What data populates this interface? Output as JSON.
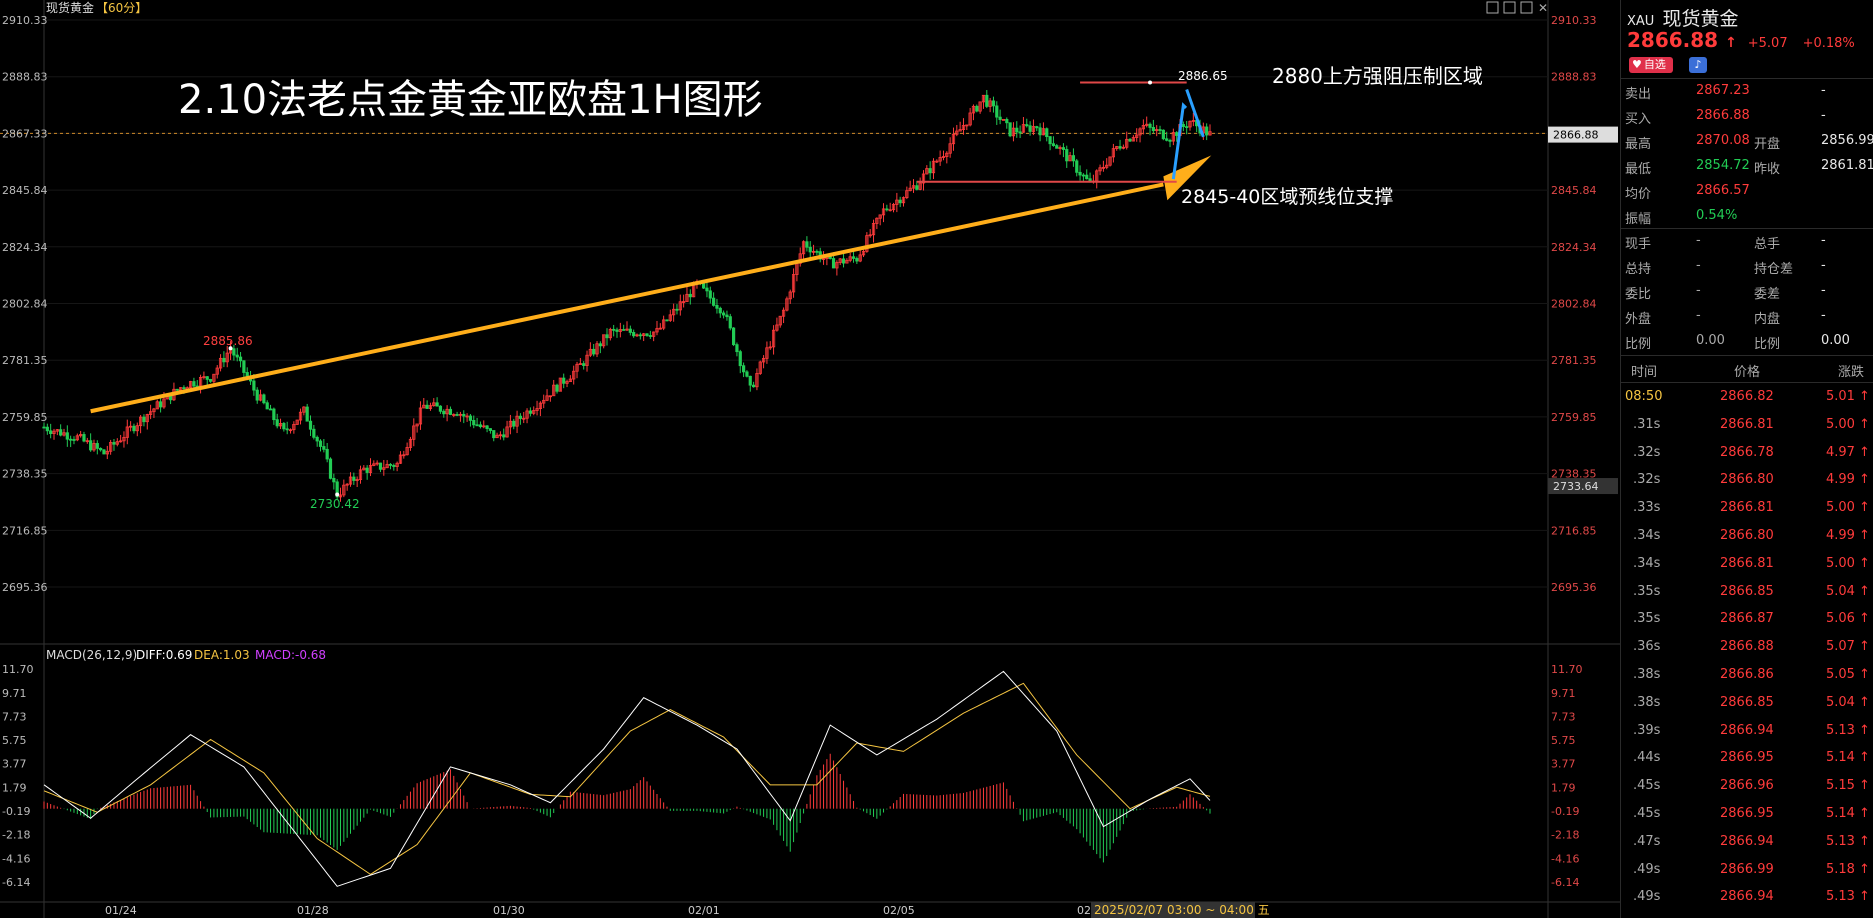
{
  "window": {
    "title": "现货黄金",
    "period": "【60分】",
    "toolbar_icons": [
      "layout-icon",
      "grid-icon",
      "window-icon",
      "close-icon"
    ]
  },
  "chart_data": [
    {
      "type": "candlestick",
      "title": "2.10法老点金黄金亚欧盘1H图形",
      "y_ticks": [
        2910.33,
        2888.83,
        2867.33,
        2845.84,
        2824.34,
        2802.84,
        2781.35,
        2759.85,
        2738.35,
        2716.85,
        2695.36
      ],
      "ylim": [
        2695.36,
        2910.33
      ],
      "x_ticks": [
        "01/24",
        "01/28",
        "01/30",
        "02/01",
        "02/05",
        "02"
      ],
      "cursor_label": "2025/02/07 03:00 ~ 04:00 五",
      "price_marker_last": "2866.88",
      "price_marker_low": "2733.64",
      "max_label": "2885.86",
      "peak_label": "2886.65",
      "min_label": "2730.42",
      "dashed_price": 2867.33,
      "key_points": [
        {
          "i": 0,
          "p": 2756
        },
        {
          "i": 10,
          "p": 2752
        },
        {
          "i": 18,
          "p": 2746
        },
        {
          "i": 30,
          "p": 2760
        },
        {
          "i": 42,
          "p": 2772
        },
        {
          "i": 50,
          "p": 2775
        },
        {
          "i": 56,
          "p": 2785.86
        },
        {
          "i": 64,
          "p": 2768
        },
        {
          "i": 72,
          "p": 2754
        },
        {
          "i": 78,
          "p": 2762
        },
        {
          "i": 84,
          "p": 2746
        },
        {
          "i": 88,
          "p": 2730.42
        },
        {
          "i": 96,
          "p": 2740
        },
        {
          "i": 106,
          "p": 2742
        },
        {
          "i": 114,
          "p": 2764
        },
        {
          "i": 124,
          "p": 2762
        },
        {
          "i": 136,
          "p": 2752
        },
        {
          "i": 148,
          "p": 2765
        },
        {
          "i": 160,
          "p": 2778
        },
        {
          "i": 170,
          "p": 2792
        },
        {
          "i": 184,
          "p": 2792
        },
        {
          "i": 196,
          "p": 2810
        },
        {
          "i": 204,
          "p": 2800
        },
        {
          "i": 212,
          "p": 2770
        },
        {
          "i": 222,
          "p": 2800
        },
        {
          "i": 228,
          "p": 2826
        },
        {
          "i": 236,
          "p": 2818
        },
        {
          "i": 244,
          "p": 2820
        },
        {
          "i": 252,
          "p": 2838
        },
        {
          "i": 262,
          "p": 2848
        },
        {
          "i": 270,
          "p": 2860
        },
        {
          "i": 282,
          "p": 2881
        },
        {
          "i": 290,
          "p": 2868
        },
        {
          "i": 298,
          "p": 2870
        },
        {
          "i": 306,
          "p": 2860
        },
        {
          "i": 314,
          "p": 2848
        },
        {
          "i": 322,
          "p": 2862
        },
        {
          "i": 330,
          "p": 2870
        },
        {
          "i": 338,
          "p": 2866
        },
        {
          "i": 344,
          "p": 2872
        },
        {
          "i": 350,
          "p": 2866.88
        }
      ],
      "annotations": [
        {
          "text": "2880上方强阻压制区域"
        },
        {
          "text": "2845-40区域预线位支撑"
        }
      ]
    },
    {
      "type": "macd",
      "header": "MACD(26,12,9)",
      "diff_label": "DIFF:0.69",
      "dea_label": "DEA:1.03",
      "macd_label": "MACD:-0.68",
      "y_ticks": [
        11.7,
        9.71,
        7.73,
        5.75,
        3.77,
        1.79,
        -0.19,
        -2.18,
        -4.16,
        -6.14
      ],
      "ylim": [
        -8.0,
        12.0
      ],
      "diff_points": [
        {
          "i": 0,
          "v": 2.0
        },
        {
          "i": 14,
          "v": -0.8
        },
        {
          "i": 28,
          "v": 2.5
        },
        {
          "i": 44,
          "v": 6.2
        },
        {
          "i": 60,
          "v": 3.5
        },
        {
          "i": 74,
          "v": -1.5
        },
        {
          "i": 88,
          "v": -6.5
        },
        {
          "i": 104,
          "v": -5.0
        },
        {
          "i": 122,
          "v": 3.5
        },
        {
          "i": 140,
          "v": 2.0
        },
        {
          "i": 152,
          "v": 0.5
        },
        {
          "i": 168,
          "v": 5.0
        },
        {
          "i": 180,
          "v": 9.3
        },
        {
          "i": 196,
          "v": 7.0
        },
        {
          "i": 208,
          "v": 5.0
        },
        {
          "i": 224,
          "v": -1.0
        },
        {
          "i": 236,
          "v": 7.0
        },
        {
          "i": 250,
          "v": 4.5
        },
        {
          "i": 268,
          "v": 7.5
        },
        {
          "i": 288,
          "v": 11.5
        },
        {
          "i": 304,
          "v": 6.5
        },
        {
          "i": 318,
          "v": -1.5
        },
        {
          "i": 332,
          "v": 0.8
        },
        {
          "i": 344,
          "v": 2.5
        },
        {
          "i": 350,
          "v": 0.69
        }
      ],
      "dea_points": [
        {
          "i": 0,
          "v": 1.5
        },
        {
          "i": 16,
          "v": -0.3
        },
        {
          "i": 32,
          "v": 2.0
        },
        {
          "i": 50,
          "v": 5.8
        },
        {
          "i": 66,
          "v": 3.0
        },
        {
          "i": 82,
          "v": -2.5
        },
        {
          "i": 98,
          "v": -5.5
        },
        {
          "i": 112,
          "v": -3.0
        },
        {
          "i": 128,
          "v": 3.0
        },
        {
          "i": 146,
          "v": 1.2
        },
        {
          "i": 158,
          "v": 1.0
        },
        {
          "i": 176,
          "v": 6.5
        },
        {
          "i": 188,
          "v": 8.3
        },
        {
          "i": 204,
          "v": 6.0
        },
        {
          "i": 218,
          "v": 2.0
        },
        {
          "i": 232,
          "v": 2.0
        },
        {
          "i": 244,
          "v": 5.5
        },
        {
          "i": 258,
          "v": 4.8
        },
        {
          "i": 276,
          "v": 8.0
        },
        {
          "i": 294,
          "v": 10.5
        },
        {
          "i": 310,
          "v": 4.5
        },
        {
          "i": 326,
          "v": 0.0
        },
        {
          "i": 340,
          "v": 1.8
        },
        {
          "i": 350,
          "v": 1.03
        }
      ]
    }
  ],
  "panel": {
    "symbol": "XAU",
    "name": "现货黄金",
    "price": "2866.88",
    "arrow": "↑",
    "change": "+5.07",
    "change_pct": "+0.18%",
    "fav_button": "自选",
    "quote": [
      {
        "label": "卖出",
        "value": "2867.23",
        "label2": "",
        "value2": "-"
      },
      {
        "label": "买入",
        "value": "2866.88",
        "label2": "",
        "value2": "-"
      },
      {
        "label": "最高",
        "value": "2870.08",
        "label2": "开盘",
        "value2": "2856.99"
      },
      {
        "label": "最低",
        "value": "2854.72",
        "label2": "昨收",
        "value2": "2861.81"
      },
      {
        "label": "均价",
        "value": "2866.57",
        "label2": "",
        "value2": ""
      },
      {
        "label": "振幅",
        "value": "0.54%",
        "label2": "",
        "value2": ""
      }
    ],
    "stats": [
      {
        "label": "现手",
        "value": "-",
        "label2": "总手",
        "value2": "-"
      },
      {
        "label": "总持",
        "value": "-",
        "label2": "持仓差",
        "value2": "-"
      },
      {
        "label": "委比",
        "value": "-",
        "label2": "委差",
        "value2": "-"
      },
      {
        "label": "外盘",
        "value": "-",
        "label2": "内盘",
        "value2": "-"
      },
      {
        "label": "比例",
        "value": "0.00",
        "label2": "比例",
        "value2": "0.00"
      }
    ],
    "ticks_header": {
      "time": "时间",
      "price": "价格",
      "change": "涨跌"
    },
    "ticks": [
      {
        "time": "08:50",
        "price": "2866.82",
        "change": "5.01"
      },
      {
        "time": ".31s",
        "price": "2866.81",
        "change": "5.00"
      },
      {
        "time": ".32s",
        "price": "2866.78",
        "change": "4.97"
      },
      {
        "time": ".32s",
        "price": "2866.80",
        "change": "4.99"
      },
      {
        "time": ".33s",
        "price": "2866.81",
        "change": "5.00"
      },
      {
        "time": ".34s",
        "price": "2866.80",
        "change": "4.99"
      },
      {
        "time": ".34s",
        "price": "2866.81",
        "change": "5.00"
      },
      {
        "time": ".35s",
        "price": "2866.85",
        "change": "5.04"
      },
      {
        "time": ".35s",
        "price": "2866.87",
        "change": "5.06"
      },
      {
        "time": ".36s",
        "price": "2866.88",
        "change": "5.07"
      },
      {
        "time": ".38s",
        "price": "2866.86",
        "change": "5.05"
      },
      {
        "time": ".38s",
        "price": "2866.85",
        "change": "5.04"
      },
      {
        "time": ".39s",
        "price": "2866.94",
        "change": "5.13"
      },
      {
        "time": ".44s",
        "price": "2866.95",
        "change": "5.14"
      },
      {
        "time": ".45s",
        "price": "2866.96",
        "change": "5.15"
      },
      {
        "time": ".45s",
        "price": "2866.95",
        "change": "5.14"
      },
      {
        "time": ".47s",
        "price": "2866.94",
        "change": "5.13"
      },
      {
        "time": ".49s",
        "price": "2866.99",
        "change": "5.18"
      },
      {
        "time": ".49s",
        "price": "2866.94",
        "change": "5.13"
      }
    ],
    "colors": {
      "up": "#ff3b3b",
      "down": "#22cc55",
      "accent": "#f5c542"
    }
  }
}
